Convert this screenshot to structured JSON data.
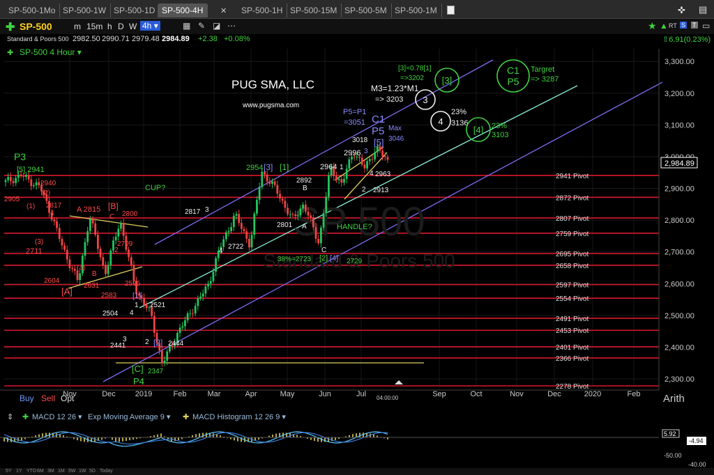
{
  "tabs": [
    {
      "label": "SP-500-1Mo"
    },
    {
      "label": "SP-500-1W"
    },
    {
      "label": "SP-500-1D"
    },
    {
      "label": "SP-500-4H"
    },
    {
      "label": "SP-500-1H"
    },
    {
      "label": "SP-500-15M"
    },
    {
      "label": "SP-500-5M"
    },
    {
      "label": "SP-500-1M"
    }
  ],
  "toolbar": {
    "symbol": "SP-500",
    "intervals": [
      "m",
      "15m",
      "h",
      "D",
      "W"
    ],
    "active_interval": "4h",
    "rt_label": "RT"
  },
  "quote": {
    "name": "Standard & Poors 500",
    "open": "2982.50",
    "high": "2990.71",
    "low": "2979.48",
    "close": "2984.89",
    "change": "+2.38",
    "change_pct": "+0.08%",
    "right_change": "6.91(0.23%)"
  },
  "chart_title": "SP-500 4 Hour",
  "watermark": {
    "line1": "SP 500",
    "line2": "Standard & Poors 500"
  },
  "brand": {
    "name": "PUG SMA, LLC",
    "url": "www.pugsma.com"
  },
  "last_price_label": "2,984.89",
  "scale_mode": "Arith",
  "time_marker": "04:00:00",
  "colors": {
    "price_up": "#22c55e",
    "price_down": "#ef4444",
    "pivot": "#d9182c",
    "channel": "#7b6cf0",
    "midchannel": "#8ff0d8",
    "trend_yellow": "#e0d060",
    "annot_red": "#ff4a4a",
    "annot_green": "#3fd23f",
    "annot_blue": "#8b8bff"
  },
  "chart_data": {
    "type": "candlestick",
    "title": "SP-500 4 Hour",
    "xlabel": "",
    "ylabel": "",
    "ylim": [
      2278,
      3340
    ],
    "x_ticks": [
      "Nov",
      "Dec",
      "2019",
      "Feb",
      "Mar",
      "Apr",
      "May",
      "Jun",
      "Jul",
      "Sep",
      "Oct",
      "Nov",
      "Dec",
      "2020",
      "Feb"
    ],
    "y_ticks": [
      "2,300.00",
      "2,400.00",
      "2,500.00",
      "2,600.00",
      "2,700.00",
      "2,800.00",
      "2,900.00",
      "3,000.00",
      "3,100.00",
      "3,200.00",
      "3,300.00"
    ],
    "y_tick_values": [
      2300,
      2400,
      2500,
      2600,
      2700,
      2800,
      2900,
      3000,
      3100,
      3200,
      3300
    ],
    "pivots": [
      {
        "label": "2941 Pivot",
        "value": 2941
      },
      {
        "label": "2872 Pivot",
        "value": 2872
      },
      {
        "label": "2807 Pivot",
        "value": 2807
      },
      {
        "label": "2759 Pivot",
        "value": 2759
      },
      {
        "label": "2695 Pivot",
        "value": 2695
      },
      {
        "label": "2658 Pivot",
        "value": 2658
      },
      {
        "label": "2597 Pivot",
        "value": 2597
      },
      {
        "label": "2554 Pivot",
        "value": 2554
      },
      {
        "label": "2491 Pivot",
        "value": 2491
      },
      {
        "label": "2453 Pivot",
        "value": 2453
      },
      {
        "label": "2401 Pivot",
        "value": 2401
      },
      {
        "label": "2366 Pivot",
        "value": 2366
      },
      {
        "label": "2278 Pivot",
        "value": 2278
      }
    ],
    "price_path_date_fraction": [
      0.0,
      0.04,
      0.09,
      0.12,
      0.15,
      0.19,
      0.22,
      0.26,
      0.3,
      0.34,
      0.38,
      0.41,
      0.45,
      0.49,
      0.53,
      0.56,
      0.6,
      0.64,
      0.67,
      0.71,
      0.75,
      0.78,
      0.82,
      0.85,
      0.88,
      0.91,
      0.94,
      0.97,
      1.0
    ],
    "price_path_values": [
      2920,
      2941,
      2905,
      2817,
      2711,
      2604,
      2815,
      2631,
      2800,
      2583,
      2504,
      2347,
      2444,
      2521,
      2595,
      2709,
      2817,
      2722,
      2954,
      2892,
      2801,
      2850,
      2729,
      2964,
      2913,
      3018,
      2963,
      3028,
      2985
    ],
    "annotations": [
      {
        "text": "P3",
        "color": "green"
      },
      {
        "text": "[5] 2941",
        "color": "green"
      },
      {
        "text": "2940",
        "color": "red"
      },
      {
        "text": "2905",
        "color": "red"
      },
      {
        "text": "(1)",
        "color": "red"
      },
      {
        "text": "(2)",
        "color": "red"
      },
      {
        "text": "2817",
        "color": "red"
      },
      {
        "text": "4",
        "color": "red"
      },
      {
        "text": "A 2815",
        "color": "red"
      },
      {
        "text": "[B]",
        "color": "red"
      },
      {
        "text": "C",
        "color": "red"
      },
      {
        "text": "2800",
        "color": "red"
      },
      {
        "text": "(3)",
        "color": "red"
      },
      {
        "text": "2711",
        "color": "red"
      },
      {
        "text": "2709",
        "color": "red"
      },
      {
        "text": "2",
        "color": "red"
      },
      {
        "text": "(4)",
        "color": "red"
      },
      {
        "text": "2604",
        "color": "red"
      },
      {
        "text": "[A]",
        "color": "red"
      },
      {
        "text": "2631",
        "color": "red"
      },
      {
        "text": "B",
        "color": "red"
      },
      {
        "text": "2595",
        "color": "red"
      },
      {
        "text": "2583",
        "color": "red"
      },
      {
        "text": "1",
        "color": "white"
      },
      {
        "text": "[1]",
        "color": "blue"
      },
      {
        "text": "2521",
        "color": "white"
      },
      {
        "text": "2504",
        "color": "white"
      },
      {
        "text": "4",
        "color": "white"
      },
      {
        "text": "3",
        "color": "white"
      },
      {
        "text": "2441",
        "color": "white"
      },
      {
        "text": "2",
        "color": "white"
      },
      {
        "text": "[2]",
        "color": "blue"
      },
      {
        "text": "2444",
        "color": "white"
      },
      {
        "text": "[C]",
        "color": "green"
      },
      {
        "text": "2347",
        "color": "green"
      },
      {
        "text": "P4",
        "color": "green"
      },
      {
        "text": "CUP?",
        "color": "green"
      },
      {
        "text": "2817",
        "color": "white"
      },
      {
        "text": "3",
        "color": "white"
      },
      {
        "text": "4",
        "color": "white"
      },
      {
        "text": "2722",
        "color": "white"
      },
      {
        "text": "2954",
        "color": "green"
      },
      {
        "text": "[3]",
        "color": "blue"
      },
      {
        "text": "[1]",
        "color": "green"
      },
      {
        "text": "2892",
        "color": "white"
      },
      {
        "text": "B",
        "color": "white"
      },
      {
        "text": "2801",
        "color": "white"
      },
      {
        "text": "A",
        "color": "white"
      },
      {
        "text": "HANDLE?",
        "color": "green"
      },
      {
        "text": "C",
        "color": "white"
      },
      {
        "text": "38%=2723",
        "color": "green"
      },
      {
        "text": "[2]",
        "color": "green"
      },
      {
        "text": "[4]",
        "color": "blue"
      },
      {
        "text": "2729",
        "color": "green"
      },
      {
        "text": "2964",
        "color": "white"
      },
      {
        "text": "1",
        "color": "white"
      },
      {
        "text": "2996",
        "color": "white"
      },
      {
        "text": "3018",
        "color": "white"
      },
      {
        "text": "3",
        "color": "blue"
      },
      {
        "text": "2",
        "color": "white"
      },
      {
        "text": "4",
        "color": "white"
      },
      {
        "text": "2963",
        "color": "white"
      },
      {
        "text": "2913",
        "color": "white"
      },
      {
        "text": "P5=P1",
        "color": "blue"
      },
      {
        "text": "=3051",
        "color": "blue"
      },
      {
        "text": "C1",
        "color": "blue"
      },
      {
        "text": "P5",
        "color": "blue"
      },
      {
        "text": "[5]",
        "color": "blue"
      },
      {
        "text": "Max",
        "color": "blue"
      },
      {
        "text": "3046",
        "color": "blue"
      },
      {
        "text": "M3=1.23*M1",
        "color": "white"
      },
      {
        "text": "=> 3203",
        "color": "white"
      },
      {
        "text": "[3]=0.78[1]",
        "color": "green"
      },
      {
        "text": "=>3202",
        "color": "green"
      },
      {
        "text": "23%",
        "color": "white"
      },
      {
        "text": "3136",
        "color": "white"
      },
      {
        "text": "23%",
        "color": "green"
      },
      {
        "text": "3103",
        "color": "green"
      },
      {
        "text": "Targret",
        "color": "green"
      },
      {
        "text": "=> 3287",
        "color": "green"
      }
    ],
    "circled_labels": [
      {
        "text": "3",
        "color": "white"
      },
      {
        "text": "4",
        "color": "white"
      },
      {
        "text": "[3]",
        "color": "green"
      },
      {
        "text": "[4]",
        "color": "green"
      },
      {
        "text": "C1 P5",
        "color": "green"
      }
    ]
  },
  "macd": {
    "labels": [
      "MACD 12 26",
      "Exp Moving Average 9",
      "MACD Histogram 12 26 9"
    ],
    "axis_labels": [
      "5.92",
      "-4.94",
      "-50.00",
      "-40.00"
    ]
  },
  "bottom_bar": {
    "ranges": [
      "5Y",
      "1Y",
      "YTD",
      "6M",
      "3M",
      "1M",
      "5W",
      "1W",
      "5D",
      "Today"
    ]
  },
  "sidebar_buttons": {
    "buy": "Buy",
    "sell": "Sell",
    "opt": "Opt"
  }
}
